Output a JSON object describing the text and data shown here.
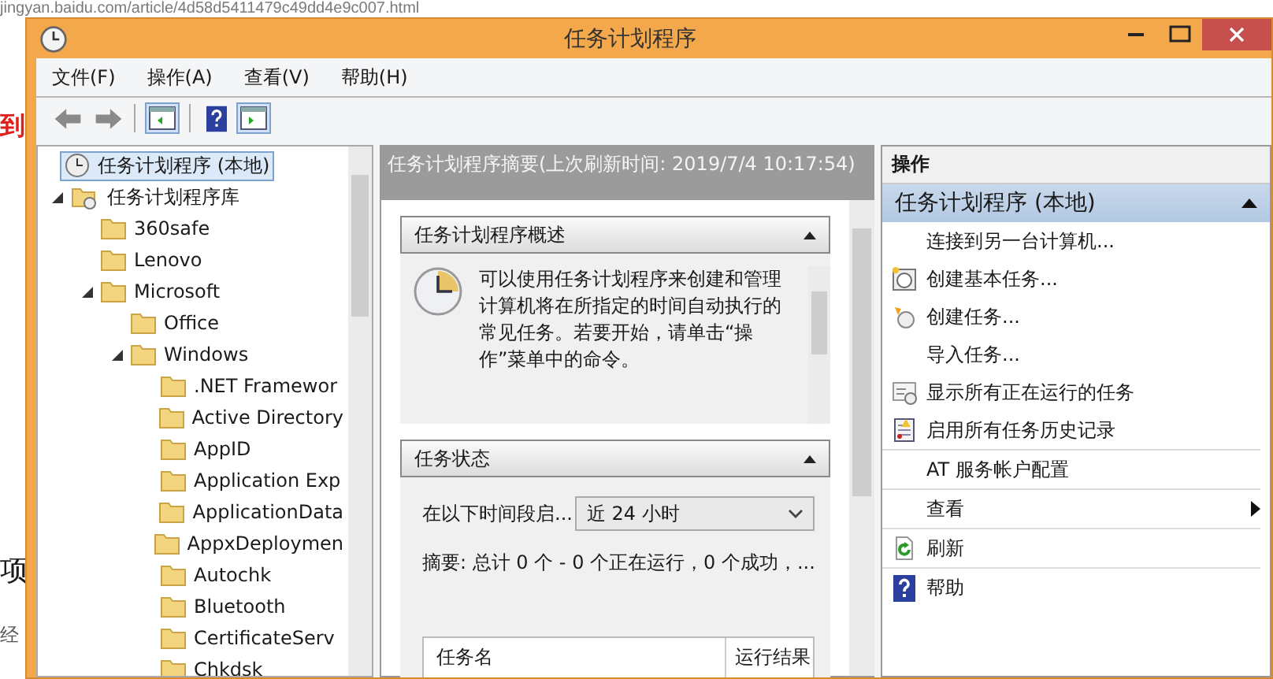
{
  "background": {
    "address": "jingyan.baidu.com/article/4d58d5411479c49dd4e9c007.html",
    "fragments": [
      "到",
      "项",
      "经"
    ]
  },
  "window": {
    "title": "任务计划程序"
  },
  "menu": [
    "文件(F)",
    "操作(A)",
    "查看(V)",
    "帮助(H)"
  ],
  "toolbar": {
    "tree_pane_on": true,
    "action_pane_on": true
  },
  "tree": [
    {
      "label": "任务计划程序 (本地)",
      "selected": true,
      "expanded": false
    },
    {
      "label": "任务计划程序库",
      "selected": false,
      "expanded": true,
      "children": [
        {
          "label": "360safe",
          "selected": false,
          "expanded": false
        },
        {
          "label": "Lenovo",
          "selected": false,
          "expanded": false
        },
        {
          "label": "Microsoft",
          "selected": false,
          "expanded": true,
          "children": [
            {
              "label": "Office",
              "selected": false,
              "expanded": false
            },
            {
              "label": "Windows",
              "selected": false,
              "expanded": true,
              "children": [
                {
                  "label": ".NET Framewor",
                  "selected": false,
                  "expanded": false
                },
                {
                  "label": "Active Directory",
                  "selected": false,
                  "expanded": false
                },
                {
                  "label": "AppID",
                  "selected": false,
                  "expanded": false
                },
                {
                  "label": "Application Exp",
                  "selected": false,
                  "expanded": false
                },
                {
                  "label": "ApplicationData",
                  "selected": false,
                  "expanded": false
                },
                {
                  "label": "AppxDeploymen",
                  "selected": false,
                  "expanded": false
                },
                {
                  "label": "Autochk",
                  "selected": false,
                  "expanded": false
                },
                {
                  "label": "Bluetooth",
                  "selected": false,
                  "expanded": false
                },
                {
                  "label": "CertificateServ",
                  "selected": false,
                  "expanded": false
                },
                {
                  "label": "Chkdsk",
                  "selected": false,
                  "expanded": false
                }
              ]
            }
          ]
        }
      ]
    }
  ],
  "summary": {
    "header": "任务计划程序摘要(上次刷新时间: 2019/7/4 10:17:54)",
    "overview": {
      "title": "任务计划程序概述",
      "expanded": true,
      "text": "可以使用任务计划程序来创建和管理计算机将在所指定的时间自动执行的常见任务。若要开始，请单击“操作”菜单中的命令。"
    },
    "status": {
      "title": "任务状态",
      "expanded": true,
      "period_label": "在以下时间段启...",
      "period_value": "近 24 小时",
      "summary_text": "摘要: 总计 0 个 - 0 个正在运行，0 个成功，...",
      "columns": [
        "任务名",
        "运行结果"
      ]
    }
  },
  "actions": {
    "header": "操作",
    "group": {
      "title": "任务计划程序 (本地)",
      "expanded": true
    },
    "items": [
      {
        "label": "连接到另一台计算机...",
        "kind": "action",
        "separator_before": false
      },
      {
        "label": "创建基本任务...",
        "kind": "action",
        "separator_before": false
      },
      {
        "label": "创建任务...",
        "kind": "action",
        "separator_before": false
      },
      {
        "label": "导入任务...",
        "kind": "action",
        "separator_before": false
      },
      {
        "label": "显示所有正在运行的任务",
        "kind": "action",
        "separator_before": false
      },
      {
        "label": "启用所有任务历史记录",
        "kind": "action",
        "separator_before": false
      },
      {
        "label": "AT 服务帐户配置",
        "kind": "action",
        "separator_before": true
      },
      {
        "label": "查看",
        "kind": "submenu",
        "separator_before": true
      },
      {
        "label": "刷新",
        "kind": "action",
        "separator_before": true
      },
      {
        "label": "帮助",
        "kind": "action",
        "separator_before": true
      }
    ]
  }
}
